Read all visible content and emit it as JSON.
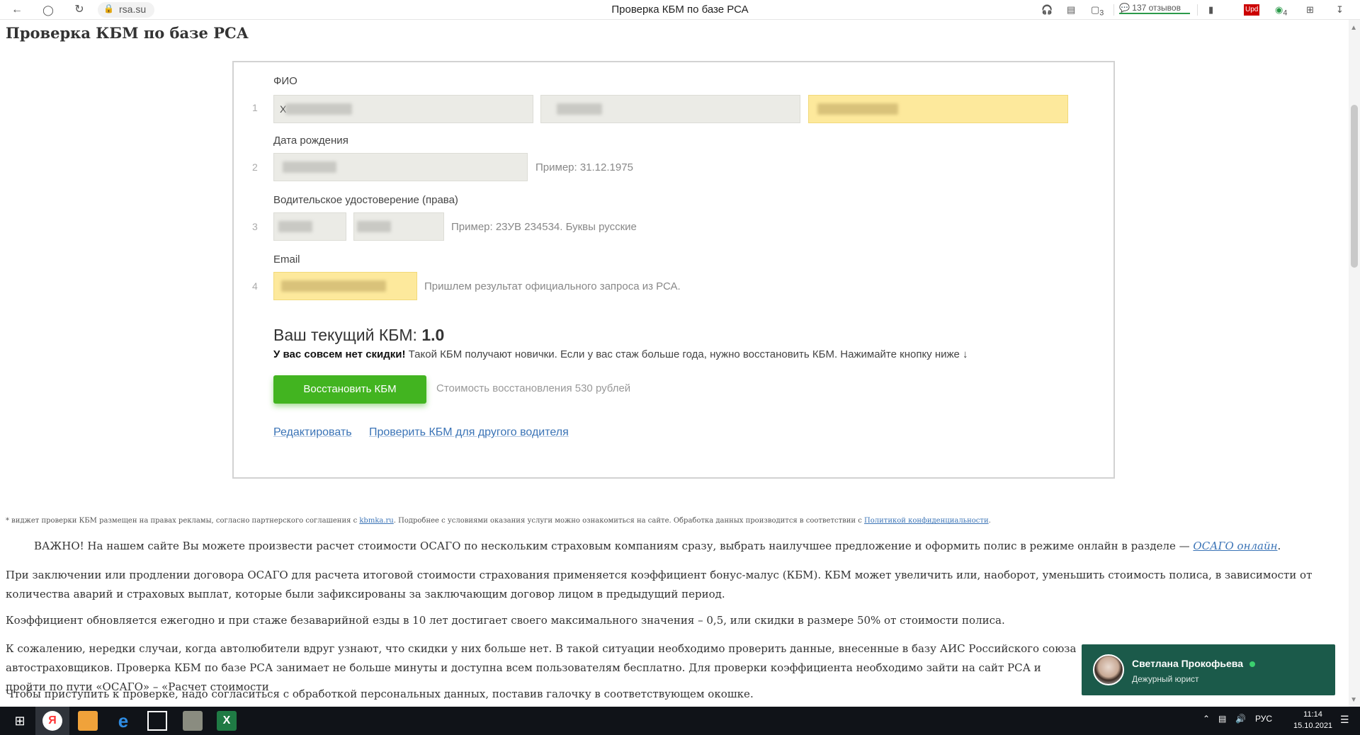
{
  "browser": {
    "back_icon": "arrow-left-icon",
    "yandex_icon": "yandex-icon",
    "reload_icon": "reload-icon",
    "address": "rsa.su",
    "tab_title": "Проверка КБМ по базе РСА",
    "reviews_label": "137 отзывов",
    "extension_badges": [
      "3",
      "4"
    ],
    "upd_label": "Upd"
  },
  "page": {
    "title": "Проверка КБМ по базе РСА"
  },
  "widget": {
    "fio_label": "ФИО",
    "birth_label": "Дата рождения",
    "birth_hint": "Пример: 31.12.1975",
    "license_label": "Водительское удостоверение (права)",
    "license_hint": "Пример: 23УВ 234534. Буквы русские",
    "email_label": "Email",
    "email_hint": "Пришлем результат официального запроса из РСА.",
    "row_numbers": [
      "1",
      "2",
      "3",
      "4"
    ],
    "fio_first_char": "Х",
    "kbm_label": "Ваш текущий КБМ:",
    "kbm_value": "1.0",
    "no_discount_bold": "У вас совсем нет скидки!",
    "no_discount_text": " Такой КБМ получают новички. Если у вас стаж больше года, нужно восстановить КБМ. Нажимайте кнопку ниже ↓",
    "restore_button": "Восстановить КБМ",
    "restore_cost": "Стоимость восстановления 530 рублей",
    "edit_link": "Редактировать",
    "other_driver_link": "Проверить КБМ для другого водителя"
  },
  "article": {
    "footnote_part1": "* виджет проверки КБМ размещен на правах рекламы, согласно партнерского соглашения с ",
    "footnote_link1": "kbmka.ru",
    "footnote_part2": ". Подробнее с условиями оказания услуги можно ознакомиться на сайте. Обработка данных производится в соответствии с ",
    "footnote_link2": "Политикой конфиденциальности",
    "footnote_part3": ".",
    "important_text": "ВАЖНО! На нашем сайте Вы можете произвести расчет стоимости ОСАГО по нескольким страховым компаниям сразу, выбрать наилучшее предложение и оформить полис в режиме онлайн в разделе — ",
    "important_link": "ОСАГО онлайн",
    "important_end": ".",
    "p1": "При заключении или продлении договора ОСАГО для расчета итоговой стоимости страхования применяется коэффициент бонус-малус (КБМ). КБМ может увеличить или, наоборот, уменьшить стоимость полиса, в зависимости от количества аварий и страховых выплат, которые были зафиксированы за заключающим договор лицом в предыдущий период.",
    "p2": "Коэффициент обновляется ежегодно и при стаже безаварийной езды в 10 лет достигает своего максимального значения – 0,5, или скидки в размере 50% от стоимости полиса.",
    "p3": "К сожалению, нередки случаи, когда автолюбители вдруг узнают, что скидки у них больше нет. В такой ситуации необходимо проверить данные, внесенные в базу АИС Российского союза автостраховщиков. Проверка КБМ по базе РСА занимает не больше минуты и доступна всем пользователям бесплатно. Для проверки коэффициента необходимо зайти на сайт РСА и пройти по пути «ОСАГО» – «Расчет стоимости",
    "p4": "Чтобы приступить к проверке, надо согласиться с обработкой персональных данных, поставив галочку в соответствующем окошке."
  },
  "chat": {
    "name": "Светлана Прокофьева",
    "role": "Дежурный юрист",
    "online_color": "#3bd16f",
    "bg_color": "#1b5a4a"
  },
  "taskbar": {
    "lang": "РУС",
    "time": "11:14",
    "date": "15.10.2021",
    "excel_letter": "X",
    "yandex_letter": "Я"
  },
  "colors": {
    "accent_button": "#42b420",
    "link": "#3a73b6",
    "highlight_field": "#fde99c"
  }
}
